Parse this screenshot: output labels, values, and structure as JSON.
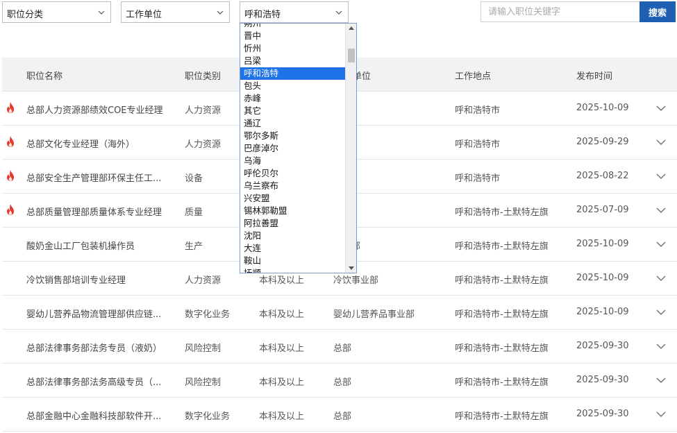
{
  "filters": {
    "category": "职位分类",
    "unit": "工作单位",
    "location": "呼和浩特"
  },
  "search": {
    "placeholder": "请输入职位关键字",
    "button": "搜索"
  },
  "table": {
    "headers": {
      "name": "职位名称",
      "category": "职位类别",
      "unit": "单位",
      "location": "工作地点",
      "date": "发布时间"
    },
    "rows": [
      {
        "hot": true,
        "name": "总部人力资源部绩效COE专业经理",
        "category": "人力资源",
        "education": "",
        "unit": "",
        "location": "呼和浩特市",
        "date": "2025-10-09"
      },
      {
        "hot": true,
        "name": "总部文化专业经理（海外）",
        "category": "人力资源",
        "education": "",
        "unit": "",
        "location": "呼和浩特市",
        "date": "2025-09-29"
      },
      {
        "hot": true,
        "name": "总部安全生产管理部环保主任工...",
        "category": "设备",
        "education": "",
        "unit": "",
        "location": "呼和浩特市",
        "date": "2025-08-22"
      },
      {
        "hot": true,
        "name": "总部质量管理部质量体系专业经理",
        "category": "质量",
        "education": "",
        "unit": "",
        "location": "呼和浩特市-土默特左旗",
        "date": "2025-07-09"
      },
      {
        "hot": false,
        "name": "酸奶金山工厂包装机操作员",
        "category": "生产",
        "education": "",
        "unit": "事业部",
        "location": "呼和浩特市-土默特左旗",
        "date": "2025-10-09"
      },
      {
        "hot": false,
        "name": "冷饮销售部培训专业经理",
        "category": "人力资源",
        "education": "本科及以上",
        "unit": "冷饮事业部",
        "location": "呼和浩特市-土默特左旗",
        "date": "2025-10-09"
      },
      {
        "hot": false,
        "name": "婴幼儿营养品物流管理部供应链...",
        "category": "数字化业务",
        "education": "本科及以上",
        "unit": "婴幼儿营养品事业部",
        "location": "呼和浩特市-土默特左旗",
        "date": "2025-10-09"
      },
      {
        "hot": false,
        "name": "总部法律事务部法务专员（液奶）",
        "category": "风险控制",
        "education": "本科及以上",
        "unit": "总部",
        "location": "呼和浩特市-土默特左旗",
        "date": "2025-09-30"
      },
      {
        "hot": false,
        "name": "总部法律事务部法务高级专员（...",
        "category": "风险控制",
        "education": "本科及以上",
        "unit": "总部",
        "location": "呼和浩特市-土默特左旗",
        "date": "2025-09-30"
      },
      {
        "hot": false,
        "name": "总部金融中心金融科技部软件开...",
        "category": "数字化业务",
        "education": "本科及以上",
        "unit": "总部",
        "location": "呼和浩特市-土默特左旗",
        "date": "2025-09-30"
      }
    ]
  },
  "dropdown": {
    "selected": "呼和浩特",
    "options": [
      "朔州",
      "晋中",
      "忻州",
      "吕梁",
      "呼和浩特",
      "包头",
      "赤峰",
      "其它",
      "通辽",
      "鄂尔多斯",
      "巴彦淖尔",
      "乌海",
      "呼伦贝尔",
      "乌兰察布",
      "兴安盟",
      "锡林郭勒盟",
      "阿拉善盟",
      "沈阳",
      "大连",
      "鞍山",
      "抚顺"
    ]
  },
  "icons": {
    "hot": "fire-icon",
    "expand": "chevron-down-icon",
    "select": "chevron-down-icon"
  },
  "colors": {
    "accent": "#1e5fb4",
    "selected_option": "#1e73e8",
    "hot": "#e23b2e",
    "header_bg": "#f2f2f2"
  }
}
